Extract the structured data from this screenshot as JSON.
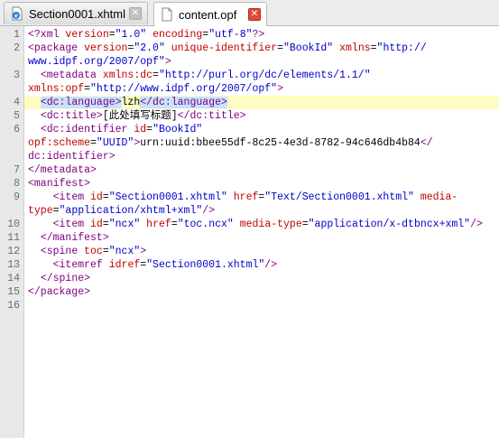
{
  "tabs": [
    {
      "label": "Section0001.xhtml",
      "icon": "xhtml-file-icon",
      "active": false
    },
    {
      "label": "content.opf",
      "icon": "document-icon",
      "active": true
    }
  ],
  "line_numbers": [
    "1",
    "2",
    "3",
    "4",
    "5",
    "6",
    "7",
    "8",
    "9",
    "10",
    "11",
    "12",
    "13",
    "14",
    "15",
    "16"
  ],
  "code_lines": [
    [
      {
        "c": "t",
        "s": "<?xml "
      },
      {
        "c": "a",
        "s": "version"
      },
      {
        "c": "n",
        "s": "="
      },
      {
        "c": "v",
        "s": "\"1.0\""
      },
      {
        "c": "n",
        "s": " "
      },
      {
        "c": "a",
        "s": "encoding"
      },
      {
        "c": "n",
        "s": "="
      },
      {
        "c": "v",
        "s": "\"utf-8\""
      },
      {
        "c": "t",
        "s": "?>"
      }
    ],
    [
      {
        "c": "t",
        "s": "<package "
      },
      {
        "c": "a",
        "s": "version"
      },
      {
        "c": "n",
        "s": "="
      },
      {
        "c": "v",
        "s": "\"2.0\""
      },
      {
        "c": "n",
        "s": " "
      },
      {
        "c": "a",
        "s": "unique-identifier"
      },
      {
        "c": "n",
        "s": "="
      },
      {
        "c": "v",
        "s": "\"BookId\""
      },
      {
        "c": "n",
        "s": " "
      },
      {
        "c": "a",
        "s": "xmlns"
      },
      {
        "c": "n",
        "s": "="
      },
      {
        "c": "v",
        "s": "\"http://"
      }
    ],
    [
      {
        "c": "v",
        "s": "www.idpf.org/2007/opf\""
      },
      {
        "c": "t",
        "s": ">"
      }
    ],
    [
      {
        "c": "n",
        "s": "  "
      },
      {
        "c": "t",
        "s": "<metadata "
      },
      {
        "c": "a",
        "s": "xmlns:dc"
      },
      {
        "c": "n",
        "s": "="
      },
      {
        "c": "v",
        "s": "\"http://purl.org/dc/elements/1.1/\""
      }
    ],
    [
      {
        "c": "a",
        "s": "xmlns:opf"
      },
      {
        "c": "n",
        "s": "="
      },
      {
        "c": "v",
        "s": "\"http://www.idpf.org/2007/opf\""
      },
      {
        "c": "t",
        "s": ">"
      }
    ],
    [
      {
        "c": "n",
        "s": "  "
      },
      {
        "c": "t",
        "s": "<dc:language>",
        "sel": true
      },
      {
        "c": "x",
        "s": "lzh"
      },
      {
        "c": "t",
        "s": "</dc:language>",
        "sel": true
      }
    ],
    [
      {
        "c": "n",
        "s": "  "
      },
      {
        "c": "t",
        "s": "<dc:title>"
      },
      {
        "c": "x",
        "s": "[此处填写标题]"
      },
      {
        "c": "t",
        "s": "</dc:title>"
      }
    ],
    [
      {
        "c": "n",
        "s": "  "
      },
      {
        "c": "t",
        "s": "<dc:identifier "
      },
      {
        "c": "a",
        "s": "id"
      },
      {
        "c": "n",
        "s": "="
      },
      {
        "c": "v",
        "s": "\"BookId\""
      }
    ],
    [
      {
        "c": "a",
        "s": "opf:scheme"
      },
      {
        "c": "n",
        "s": "="
      },
      {
        "c": "v",
        "s": "\"UUID\""
      },
      {
        "c": "t",
        "s": ">"
      },
      {
        "c": "x",
        "s": "urn:uuid:bbee55df-8c25-4e3d-8782-94c646db4b84"
      },
      {
        "c": "t",
        "s": "</"
      }
    ],
    [
      {
        "c": "t",
        "s": "dc:identifier>"
      }
    ],
    [
      {
        "c": "t",
        "s": "</metadata>"
      }
    ],
    [
      {
        "c": "t",
        "s": "<manifest>"
      }
    ],
    [
      {
        "c": "n",
        "s": "    "
      },
      {
        "c": "t",
        "s": "<item "
      },
      {
        "c": "a",
        "s": "id"
      },
      {
        "c": "n",
        "s": "="
      },
      {
        "c": "v",
        "s": "\"Section0001.xhtml\""
      },
      {
        "c": "n",
        "s": " "
      },
      {
        "c": "a",
        "s": "href"
      },
      {
        "c": "n",
        "s": "="
      },
      {
        "c": "v",
        "s": "\"Text/Section0001.xhtml\""
      },
      {
        "c": "n",
        "s": " "
      },
      {
        "c": "a",
        "s": "media-"
      }
    ],
    [
      {
        "c": "a",
        "s": "type"
      },
      {
        "c": "n",
        "s": "="
      },
      {
        "c": "v",
        "s": "\"application/xhtml+xml\""
      },
      {
        "c": "t",
        "s": "/>"
      }
    ],
    [
      {
        "c": "n",
        "s": "    "
      },
      {
        "c": "t",
        "s": "<item "
      },
      {
        "c": "a",
        "s": "id"
      },
      {
        "c": "n",
        "s": "="
      },
      {
        "c": "v",
        "s": "\"ncx\""
      },
      {
        "c": "n",
        "s": " "
      },
      {
        "c": "a",
        "s": "href"
      },
      {
        "c": "n",
        "s": "="
      },
      {
        "c": "v",
        "s": "\"toc.ncx\""
      },
      {
        "c": "n",
        "s": " "
      },
      {
        "c": "a",
        "s": "media-type"
      },
      {
        "c": "n",
        "s": "="
      },
      {
        "c": "v",
        "s": "\"application/x-dtbncx+xml\""
      },
      {
        "c": "t",
        "s": "/>"
      }
    ],
    [
      {
        "c": "n",
        "s": "  "
      },
      {
        "c": "t",
        "s": "</manifest>"
      }
    ],
    [
      {
        "c": "n",
        "s": "  "
      },
      {
        "c": "t",
        "s": "<spine "
      },
      {
        "c": "a",
        "s": "toc"
      },
      {
        "c": "n",
        "s": "="
      },
      {
        "c": "v",
        "s": "\"ncx\""
      },
      {
        "c": "t",
        "s": ">"
      }
    ],
    [
      {
        "c": "n",
        "s": "    "
      },
      {
        "c": "t",
        "s": "<itemref "
      },
      {
        "c": "a",
        "s": "idref"
      },
      {
        "c": "n",
        "s": "="
      },
      {
        "c": "v",
        "s": "\"Section0001.xhtml\""
      },
      {
        "c": "t",
        "s": "/>"
      }
    ],
    [
      {
        "c": "n",
        "s": "  "
      },
      {
        "c": "t",
        "s": "</spine>"
      }
    ],
    [
      {
        "c": "t",
        "s": "</package>"
      }
    ],
    []
  ],
  "line_number_rows": [
    0,
    1,
    3,
    5,
    6,
    7,
    10,
    11,
    12,
    14,
    15,
    16,
    17,
    18,
    19,
    20
  ],
  "highlighted_row": 5,
  "colors": {
    "tag": "#800080",
    "attribute": "#c00000",
    "value": "#0000c8",
    "current_line": "#fdfdc3",
    "selection": "#c8e2ff",
    "close_red": "#e04a3a"
  }
}
